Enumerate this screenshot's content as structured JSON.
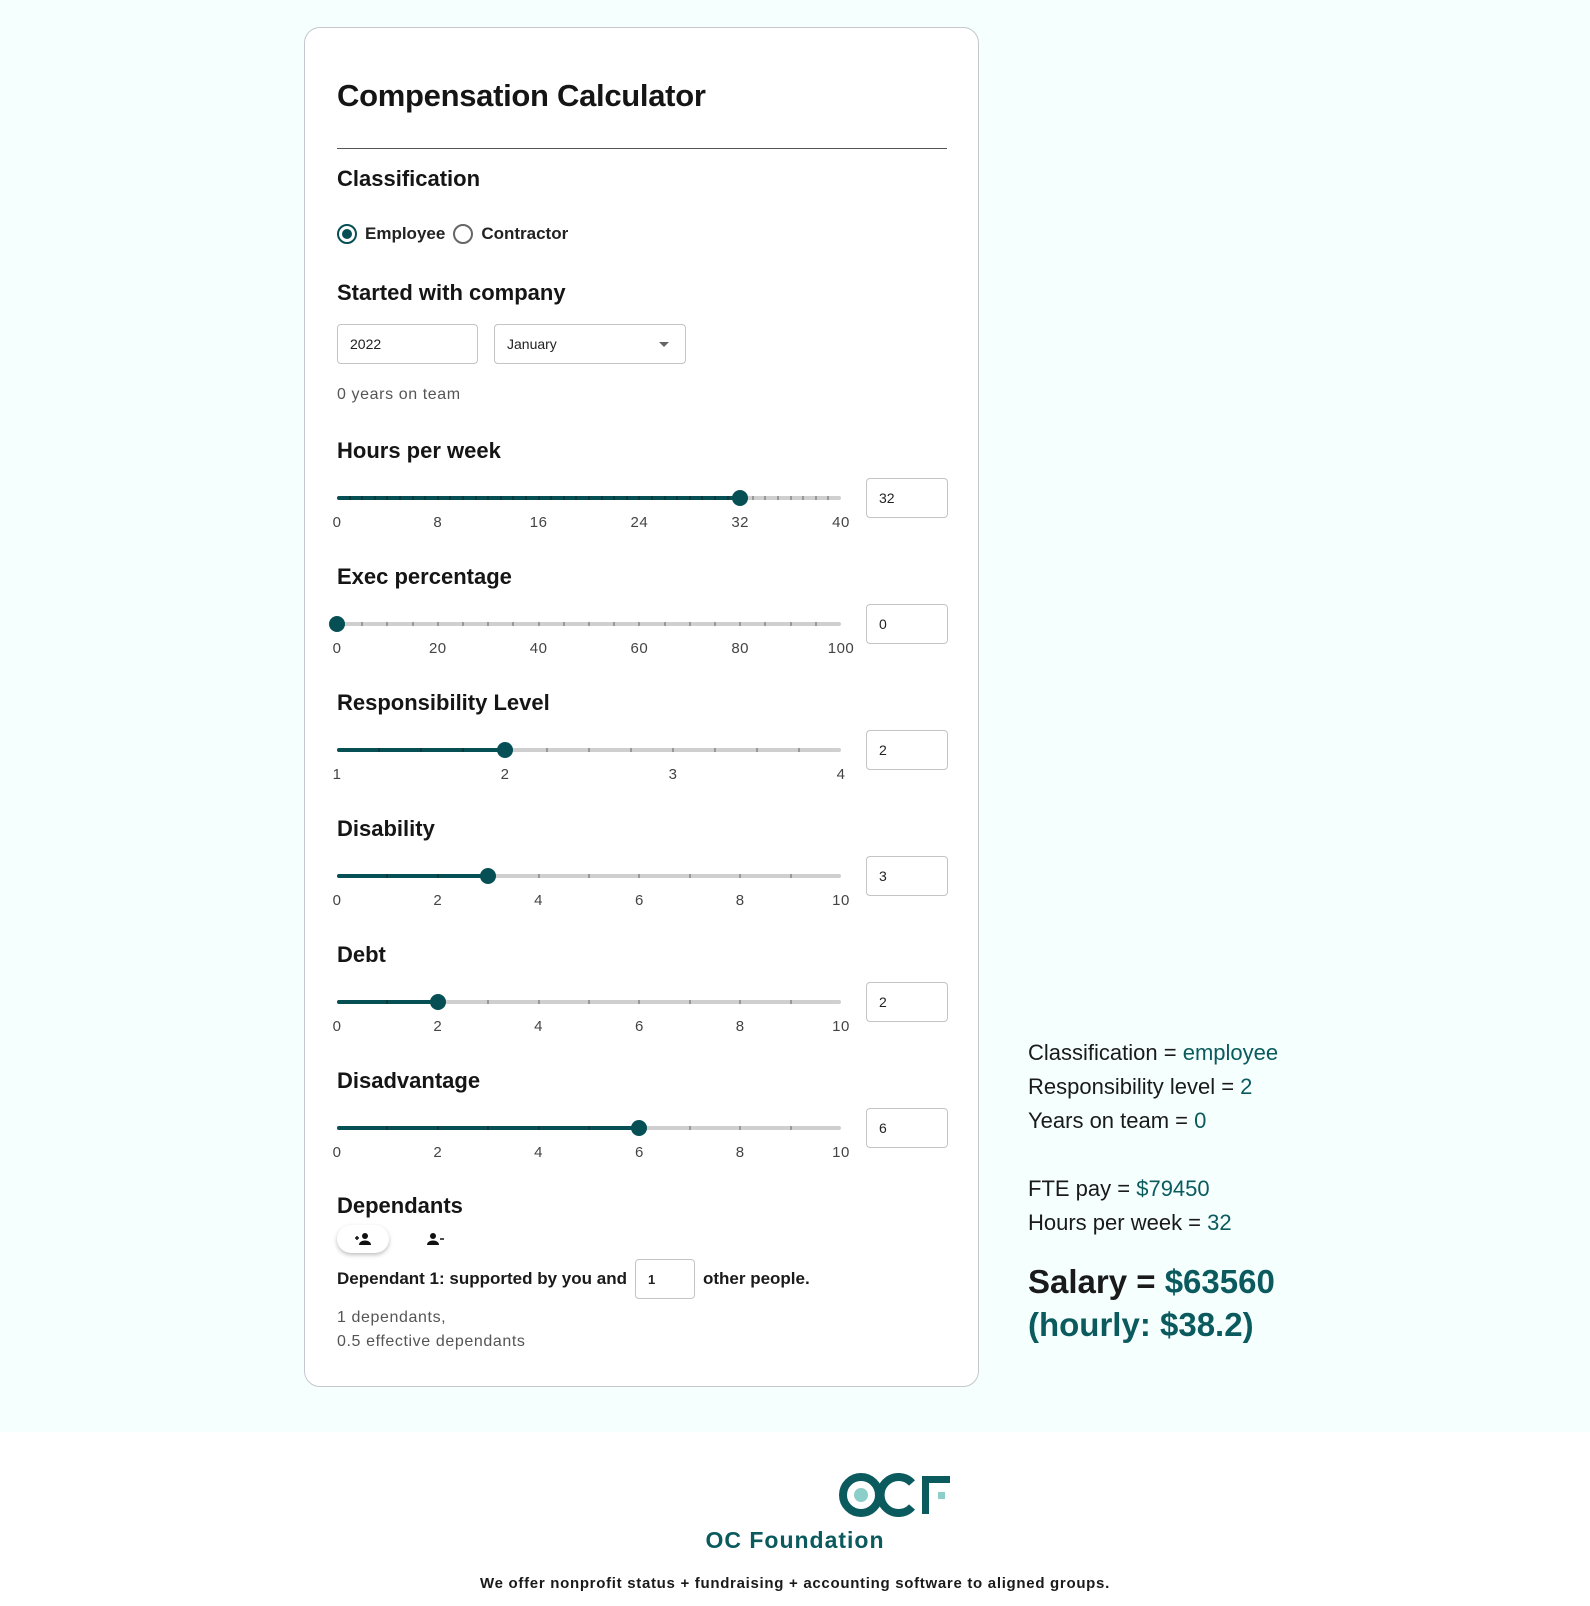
{
  "calculator": {
    "title": "Compensation Calculator",
    "classification": {
      "label": "Classification",
      "options": [
        {
          "label": "Employee",
          "checked": true
        },
        {
          "label": "Contractor",
          "checked": false
        }
      ]
    },
    "started": {
      "label": "Started with company",
      "year": "2022",
      "month": "January",
      "helper": "0 years on team"
    },
    "sliders": [
      {
        "key": "hours",
        "label": "Hours per week",
        "min": 0,
        "max": 40,
        "step": 1,
        "value": 32,
        "value_text": "32",
        "ticks": [
          "0",
          "8",
          "16",
          "24",
          "32",
          "40"
        ]
      },
      {
        "key": "exec",
        "label": "Exec percentage",
        "min": 0,
        "max": 100,
        "step": 5,
        "value": 0,
        "value_text": "0",
        "ticks": [
          "0",
          "20",
          "40",
          "60",
          "80",
          "100"
        ]
      },
      {
        "key": "responsibility",
        "label": "Responsibility Level",
        "min": 1,
        "max": 4,
        "step": 0.25,
        "value": 2,
        "value_text": "2",
        "ticks": [
          "1",
          "2",
          "3",
          "4"
        ]
      },
      {
        "key": "disability",
        "label": "Disability",
        "min": 0,
        "max": 10,
        "step": 1,
        "value": 3,
        "value_text": "3",
        "ticks": [
          "0",
          "2",
          "4",
          "6",
          "8",
          "10"
        ]
      },
      {
        "key": "debt",
        "label": "Debt",
        "min": 0,
        "max": 10,
        "step": 1,
        "value": 2,
        "value_text": "2",
        "ticks": [
          "0",
          "2",
          "4",
          "6",
          "8",
          "10"
        ]
      },
      {
        "key": "disadvantage",
        "label": "Disadvantage",
        "min": 0,
        "max": 10,
        "step": 1,
        "value": 6,
        "value_text": "6",
        "ticks": [
          "0",
          "2",
          "4",
          "6",
          "8",
          "10"
        ]
      }
    ],
    "dependants": {
      "label": "Dependants",
      "add_icon": "person-add-icon",
      "remove_icon": "person-remove-icon",
      "line_prefix": "Dependant 1: supported by you and",
      "others_value": "1",
      "line_suffix": "other people.",
      "summary_1": "1 dependants,",
      "summary_2": "0.5 effective dependants"
    }
  },
  "results": {
    "classification_label": "Classification =",
    "classification_value": "employee",
    "responsibility_label": "Responsibility level =",
    "responsibility_value": "2",
    "years_label": "Years on team =",
    "years_value": "0",
    "fte_label": "FTE pay =",
    "fte_value": "$79450",
    "hours_label": "Hours per week =",
    "hours_value": "32",
    "salary_label": "Salary =",
    "salary_value": "$63560",
    "hourly_text": "(hourly: $38.2)"
  },
  "footer": {
    "logo_text": "OCF",
    "org_name": "OC Foundation",
    "tagline": "We offer nonprofit status + fundraising + accounting software to aligned groups."
  },
  "colors": {
    "accent": "#064f54",
    "background": "#f5fffe",
    "logo_light": "#8ccfc8"
  }
}
